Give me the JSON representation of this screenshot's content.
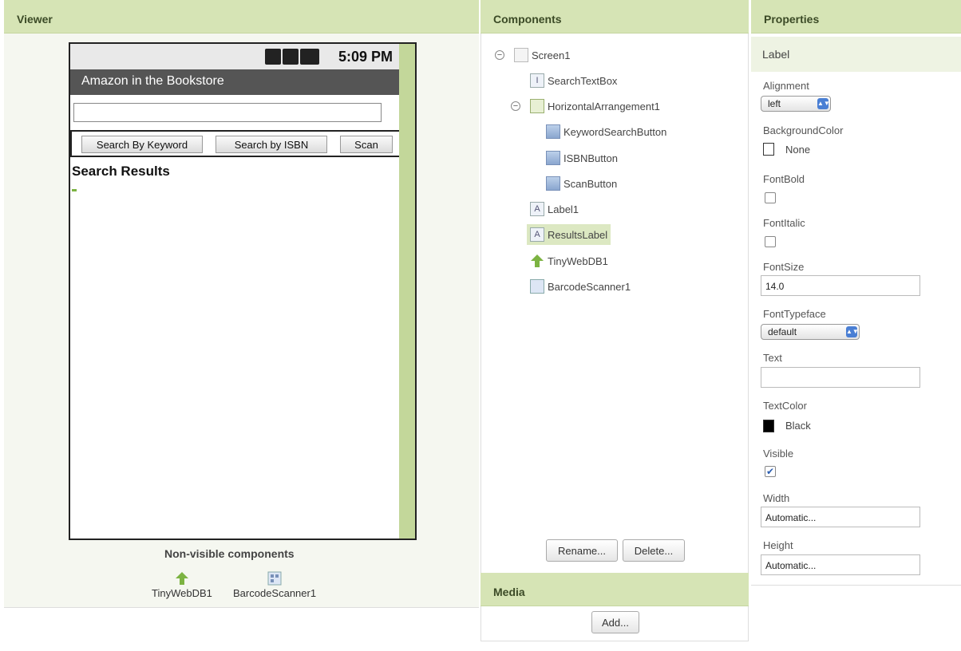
{
  "viewer": {
    "header": "Viewer",
    "phone": {
      "time": "5:09 PM",
      "title": "Amazon in the Bookstore",
      "buttons": [
        "Search By Keyword",
        "Search by ISBN",
        "Scan"
      ],
      "results_label": "Search Results"
    },
    "nonvisible_title": "Non-visible components",
    "nonvisible_items": [
      "TinyWebDB1",
      "BarcodeScanner1"
    ]
  },
  "components": {
    "header": "Components",
    "tree": {
      "screen": "Screen1",
      "search_textbox": "SearchTextBox",
      "harr": "HorizontalArrangement1",
      "keyword_button": "KeywordSearchButton",
      "isbn_button": "ISBNButton",
      "scan_button": "ScanButton",
      "label1": "Label1",
      "results_label": "ResultsLabel",
      "tinywebdb": "TinyWebDB1",
      "barcode": "BarcodeScanner1"
    },
    "rename_label": "Rename...",
    "delete_label": "Delete..."
  },
  "media": {
    "header": "Media",
    "add_label": "Add..."
  },
  "properties": {
    "header": "Properties",
    "component": "Label",
    "alignment_label": "Alignment",
    "alignment_value": "left",
    "bgcolor_label": "BackgroundColor",
    "bgcolor_value": "None",
    "fontbold_label": "FontBold",
    "fontitalic_label": "FontItalic",
    "fontsize_label": "FontSize",
    "fontsize_value": "14.0",
    "typeface_label": "FontTypeface",
    "typeface_value": "default",
    "text_label": "Text",
    "text_value": "",
    "textcolor_label": "TextColor",
    "textcolor_value": "Black",
    "visible_label": "Visible",
    "width_label": "Width",
    "width_value": "Automatic...",
    "height_label": "Height",
    "height_value": "Automatic..."
  },
  "colors": {
    "header_bg": "#d6e4b5",
    "selected_bg": "#dce8c2",
    "textcolor_swatch": "#000000"
  }
}
